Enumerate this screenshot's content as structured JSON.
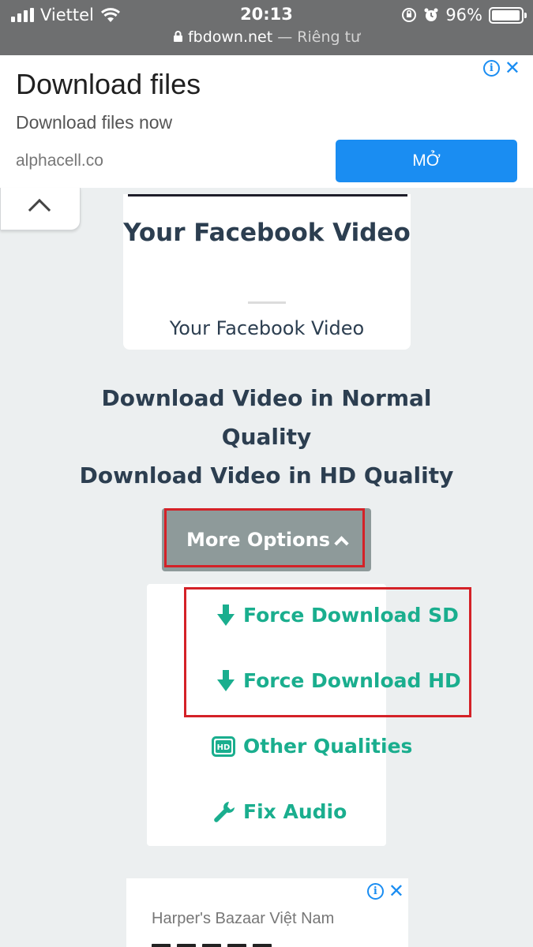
{
  "status_bar": {
    "carrier": "Viettel",
    "time": "20:13",
    "battery": "96%",
    "battery_level": 0.96,
    "url": "fbdown.net",
    "url_suffix": "— Riêng tư"
  },
  "top_ad": {
    "title": "Download files",
    "subtitle": "Download files now",
    "domain": "alphacell.co",
    "button_label": "MỞ",
    "accent_color": "#1a8df2"
  },
  "video_card": {
    "title": "Your Facebook Video",
    "caption": "Your Facebook Video"
  },
  "download_links": {
    "normal": "Download Video in Normal Quality",
    "hd": "Download Video in HD Quality"
  },
  "more_options": {
    "label": "More Options"
  },
  "options": [
    {
      "label": "Force Download SD",
      "icon": "download-arrow-icon"
    },
    {
      "label": "Force Download HD",
      "icon": "download-arrow-icon"
    },
    {
      "label": "Other Qualities",
      "icon": "hd-icon"
    },
    {
      "label": "Fix Audio",
      "icon": "wrench-icon"
    }
  ],
  "bottom_ad": {
    "source": "Harper's Bazaar Việt Nam"
  },
  "colors": {
    "heading": "#2c3e50",
    "option_green": "#1aae8e",
    "highlight_red": "#d42127",
    "more_button": "#8e9a9a"
  }
}
